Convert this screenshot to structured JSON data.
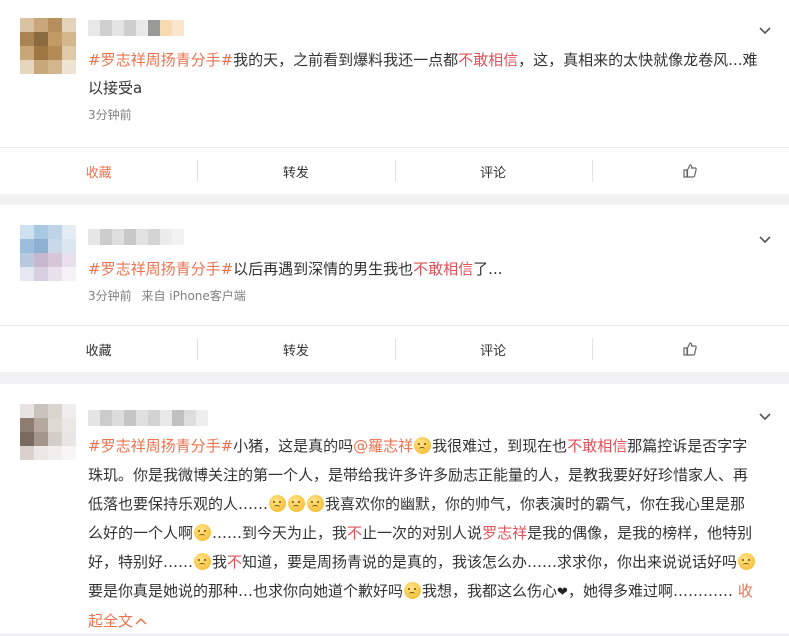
{
  "posts": [
    {
      "topic": "#罗志祥周扬青分手#",
      "text_1": "我的天，之前看到爆料我还一点都",
      "keyword": "不敢相信",
      "text_2": "，这，真相来的太快就像龙卷风...难以接受a",
      "time": "3分钟前",
      "source": "",
      "actions": [
        "收藏",
        "转发",
        "评论"
      ]
    },
    {
      "topic": "#罗志祥周扬青分手#",
      "text_1": "以后再遇到深情的男生我也",
      "keyword": "不敢相信",
      "text_2": "了...",
      "time": "3分钟前",
      "source": "来自 iPhone客户端",
      "actions": [
        "收藏",
        "转发",
        "评论"
      ]
    },
    {
      "topic": "#罗志祥周扬青分手#",
      "seg_1": "小猪，这是真的吗",
      "mention": "@羅志祥",
      "seg_2": "我很难过，到现在也",
      "keyword": "不敢相信",
      "seg_3": "那篇控诉是否字字珠玑。你是我微博关注的第一个人，是带给我许多许多励志正能量的人，是教我要好好珍惜家人、再低落也要保持乐观的人……",
      "seg_4": "我喜欢你的幽默，你的帅气，你表演时的霸气，你在我心里是那么好的一个人啊",
      "seg_5": "……到今天为止，我",
      "kw_not": "不",
      "seg_6": "止一次的对别人说",
      "name_link": "罗志祥",
      "seg_7": "是我的偶像，是我的榜样，他特别好，特别好……",
      "seg_8": "我",
      "seg_9": "知道，要是周扬青说的是真的，我该怎么办……求求你，你出来说说话好吗",
      "seg_10": "要是你真是她说的那种…也求你向她道个歉好吗",
      "seg_11": "我想，我都这么伤心",
      "seg_12": "，她得多难过啊…………",
      "collapse": "收起全文"
    }
  ],
  "icons": {
    "more": "chevron-down-icon",
    "like": "thumb-up-icon",
    "emoji": "sad-face-emoji",
    "heart": "broken-heart-icon"
  },
  "colors": {
    "topic": "#eb7350",
    "keyword": "#e0515a",
    "bg": "#f2f2f5"
  }
}
